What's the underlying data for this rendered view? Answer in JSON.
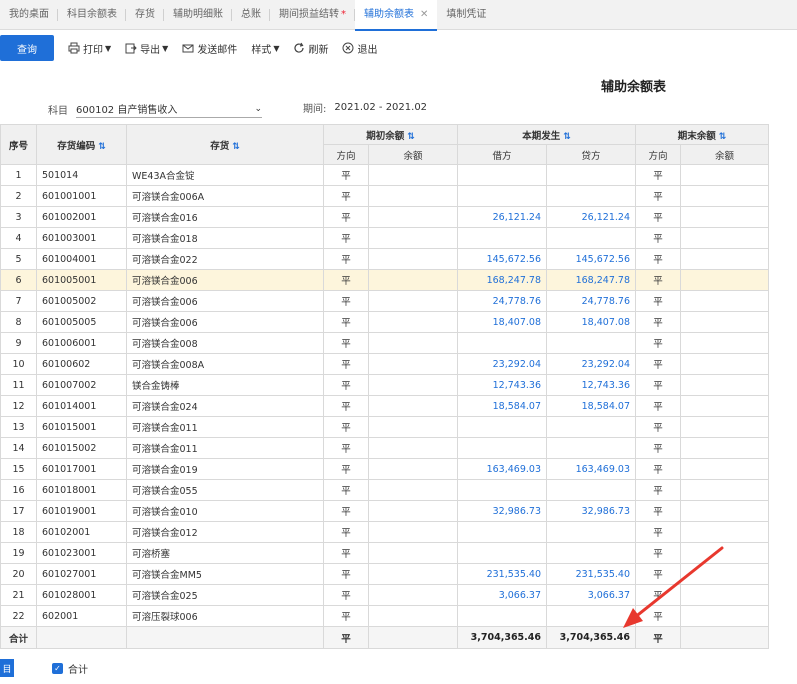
{
  "tabs": [
    {
      "label": "我的桌面",
      "active": false,
      "modified": false
    },
    {
      "label": "科目余额表",
      "active": false,
      "modified": false
    },
    {
      "label": "存货",
      "active": false,
      "modified": false
    },
    {
      "label": "辅助明细账",
      "active": false,
      "modified": false
    },
    {
      "label": "总账",
      "active": false,
      "modified": false
    },
    {
      "label": "期间损益结转",
      "active": false,
      "modified": true
    },
    {
      "label": "辅助余额表",
      "active": true,
      "modified": false
    },
    {
      "label": "填制凭证",
      "active": false,
      "modified": false
    }
  ],
  "toolbar": {
    "query": "查询",
    "print": "打印",
    "export": "导出",
    "email": "发送邮件",
    "style": "样式",
    "refresh": "刷新",
    "exit": "退出"
  },
  "report": {
    "title": "辅助余额表",
    "subject_label": "科目",
    "subject_value": "600102 自产销售收入",
    "period_label": "期间:",
    "period_value": "2021.02 - 2021.02"
  },
  "table": {
    "headers": {
      "seq": "序号",
      "code": "存货编码",
      "name": "存货",
      "opening": "期初余额",
      "current": "本期发生",
      "closing": "期末余额",
      "direction": "方向",
      "balance": "余额",
      "debit": "借方",
      "credit": "贷方"
    },
    "rows": [
      {
        "seq": "1",
        "code": "501014",
        "name": "WE43A合金锭",
        "dir1": "平",
        "debit": "",
        "credit": "",
        "dir2": "平"
      },
      {
        "seq": "2",
        "code": "601001001",
        "name": "可溶镁合金006A",
        "dir1": "平",
        "debit": "",
        "credit": "",
        "dir2": "平"
      },
      {
        "seq": "3",
        "code": "601002001",
        "name": "可溶镁合金016",
        "dir1": "平",
        "debit": "26,121.24",
        "credit": "26,121.24",
        "dir2": "平"
      },
      {
        "seq": "4",
        "code": "601003001",
        "name": "可溶镁合金018",
        "dir1": "平",
        "debit": "",
        "credit": "",
        "dir2": "平"
      },
      {
        "seq": "5",
        "code": "601004001",
        "name": "可溶镁合金022",
        "dir1": "平",
        "debit": "145,672.56",
        "credit": "145,672.56",
        "dir2": "平"
      },
      {
        "seq": "6",
        "code": "601005001",
        "name": "可溶镁合金006",
        "dir1": "平",
        "debit": "168,247.78",
        "credit": "168,247.78",
        "dir2": "平"
      },
      {
        "seq": "7",
        "code": "601005002",
        "name": "可溶镁合金006",
        "dir1": "平",
        "debit": "24,778.76",
        "credit": "24,778.76",
        "dir2": "平"
      },
      {
        "seq": "8",
        "code": "601005005",
        "name": "可溶镁合金006",
        "dir1": "平",
        "debit": "18,407.08",
        "credit": "18,407.08",
        "dir2": "平"
      },
      {
        "seq": "9",
        "code": "601006001",
        "name": "可溶镁合金008",
        "dir1": "平",
        "debit": "",
        "credit": "",
        "dir2": "平"
      },
      {
        "seq": "10",
        "code": "60100602",
        "name": "可溶镁合金008A",
        "dir1": "平",
        "debit": "23,292.04",
        "credit": "23,292.04",
        "dir2": "平"
      },
      {
        "seq": "11",
        "code": "601007002",
        "name": "镁合金铸棒",
        "dir1": "平",
        "debit": "12,743.36",
        "credit": "12,743.36",
        "dir2": "平"
      },
      {
        "seq": "12",
        "code": "601014001",
        "name": "可溶镁合金024",
        "dir1": "平",
        "debit": "18,584.07",
        "credit": "18,584.07",
        "dir2": "平"
      },
      {
        "seq": "13",
        "code": "601015001",
        "name": "可溶镁合金011",
        "dir1": "平",
        "debit": "",
        "credit": "",
        "dir2": "平"
      },
      {
        "seq": "14",
        "code": "601015002",
        "name": "可溶镁合金011",
        "dir1": "平",
        "debit": "",
        "credit": "",
        "dir2": "平"
      },
      {
        "seq": "15",
        "code": "601017001",
        "name": "可溶镁合金019",
        "dir1": "平",
        "debit": "163,469.03",
        "credit": "163,469.03",
        "dir2": "平"
      },
      {
        "seq": "16",
        "code": "601018001",
        "name": "可溶镁合金055",
        "dir1": "平",
        "debit": "",
        "credit": "",
        "dir2": "平"
      },
      {
        "seq": "17",
        "code": "601019001",
        "name": "可溶镁合金010",
        "dir1": "平",
        "debit": "32,986.73",
        "credit": "32,986.73",
        "dir2": "平"
      },
      {
        "seq": "18",
        "code": "60102001",
        "name": "可溶镁合金012",
        "dir1": "平",
        "debit": "",
        "credit": "",
        "dir2": "平"
      },
      {
        "seq": "19",
        "code": "601023001",
        "name": "可溶桥塞",
        "dir1": "平",
        "debit": "",
        "credit": "",
        "dir2": "平"
      },
      {
        "seq": "20",
        "code": "601027001",
        "name": "可溶镁合金MM5",
        "dir1": "平",
        "debit": "231,535.40",
        "credit": "231,535.40",
        "dir2": "平"
      },
      {
        "seq": "21",
        "code": "601028001",
        "name": "可溶镁合金025",
        "dir1": "平",
        "debit": "3,066.37",
        "credit": "3,066.37",
        "dir2": "平"
      },
      {
        "seq": "22",
        "code": "602001",
        "name": "可溶压裂球006",
        "dir1": "平",
        "debit": "",
        "credit": "",
        "dir2": "平"
      }
    ],
    "highlighted_row": 6,
    "total": {
      "label": "合计",
      "dir1": "平",
      "debit": "3,704,365.46",
      "credit": "3,704,365.46",
      "dir2": "平"
    }
  },
  "footer": {
    "left_button": "目",
    "sum_checkbox_label": "合计",
    "sum_checked": true
  },
  "colors": {
    "accent": "#1f6fd8",
    "highlight_row": "#fdf5dc",
    "arrow": "#e8382e"
  }
}
